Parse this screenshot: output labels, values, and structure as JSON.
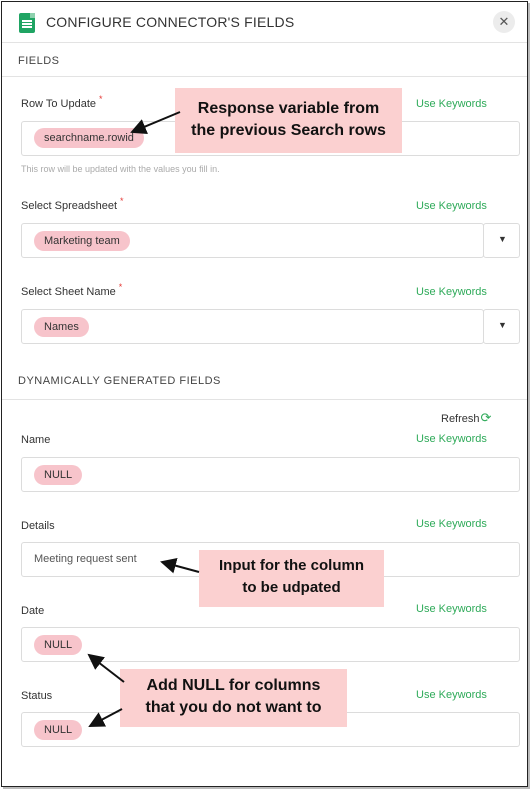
{
  "header": {
    "title": "CONFIGURE CONNECTOR'S FIELDS",
    "close_icon": "✕"
  },
  "sections": {
    "fields": "FIELDS",
    "dynamic": "DYNAMICALLY GENERATED FIELDS"
  },
  "use_keywords": "Use Keywords",
  "required_mark": "*",
  "row_to_update": {
    "label": "Row To Update",
    "value": "searchname.rowid",
    "hint": "This row will be updated with the values you fill in."
  },
  "spreadsheet": {
    "label": "Select Spreadsheet",
    "value": "Marketing team"
  },
  "sheet_name": {
    "label": "Select Sheet Name",
    "value": "Names"
  },
  "refresh": {
    "label": "Refresh",
    "icon": "⟳"
  },
  "dynamic_fields": {
    "name": {
      "label": "Name",
      "value": "NULL"
    },
    "details": {
      "label": "Details",
      "value": "Meeting request sent"
    },
    "date": {
      "label": "Date",
      "value": "NULL"
    },
    "status": {
      "label": "Status",
      "value": "NULL"
    }
  },
  "annotations": {
    "response_variable": {
      "line1": "Response variable from",
      "line2": "the previous Search rows"
    },
    "input_column": {
      "line1": "Input for the column",
      "line2": "to be udpated"
    },
    "add_null": {
      "line1": "Add NULL for columns",
      "line2": "that you do not want to"
    }
  },
  "colors": {
    "accent_green": "#2eaa59",
    "chip_pink": "#f7c4cb",
    "callout_pink": "#fbd0d0"
  }
}
